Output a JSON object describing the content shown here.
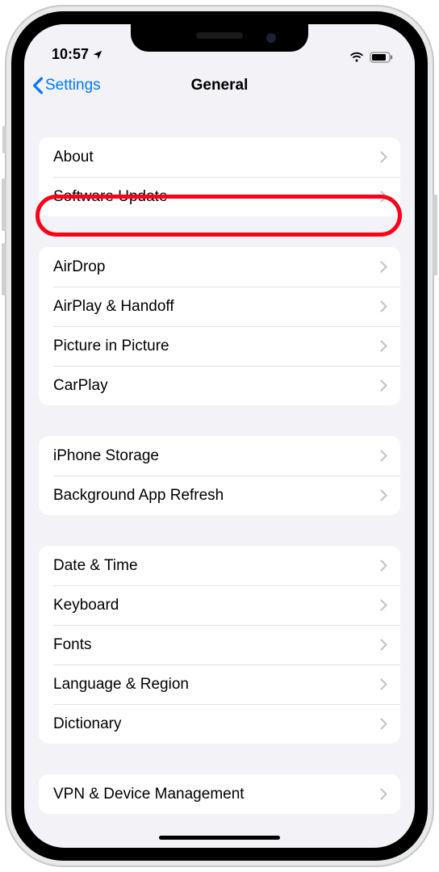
{
  "status": {
    "time": "10:57",
    "location_icon": "location-arrow",
    "wifi_icon": "wifi",
    "battery_icon": "battery"
  },
  "nav": {
    "back_label": "Settings",
    "title": "General"
  },
  "groups": [
    {
      "rows": [
        {
          "key": "about",
          "label": "About"
        },
        {
          "key": "software-update",
          "label": "Software Update",
          "highlighted": true
        }
      ]
    },
    {
      "rows": [
        {
          "key": "airdrop",
          "label": "AirDrop"
        },
        {
          "key": "airplay-handoff",
          "label": "AirPlay & Handoff"
        },
        {
          "key": "picture-in-picture",
          "label": "Picture in Picture"
        },
        {
          "key": "carplay",
          "label": "CarPlay"
        }
      ]
    },
    {
      "rows": [
        {
          "key": "iphone-storage",
          "label": "iPhone Storage"
        },
        {
          "key": "background-app-refresh",
          "label": "Background App Refresh"
        }
      ]
    },
    {
      "rows": [
        {
          "key": "date-time",
          "label": "Date & Time"
        },
        {
          "key": "keyboard",
          "label": "Keyboard"
        },
        {
          "key": "fonts",
          "label": "Fonts"
        },
        {
          "key": "language-region",
          "label": "Language & Region"
        },
        {
          "key": "dictionary",
          "label": "Dictionary"
        }
      ]
    },
    {
      "rows": [
        {
          "key": "vpn-device-management",
          "label": "VPN & Device Management"
        }
      ]
    }
  ]
}
